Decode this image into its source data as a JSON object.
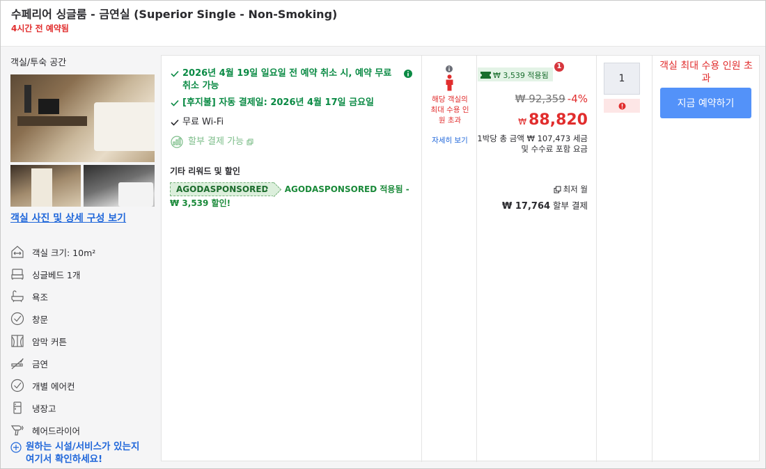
{
  "header": {
    "room_title": "수페리어 싱글룸 - 금연실 (Superior Single - Non-Smoking)",
    "booked_ago": "4시간 전 예약됨"
  },
  "left": {
    "room_type": "객실/투숙 공간",
    "photo_link": "객실 사진 및 상세 구성 보기",
    "amenities": [
      {
        "icon": "room-size-icon",
        "label": "객실 크기: 10m²"
      },
      {
        "icon": "single-bed-icon",
        "label": "싱글베드 1개"
      },
      {
        "icon": "bathtub-icon",
        "label": "욕조"
      },
      {
        "icon": "check-circle-icon",
        "label": "창문"
      },
      {
        "icon": "curtain-icon",
        "label": "암막 커튼"
      },
      {
        "icon": "no-smoking-icon",
        "label": "금연"
      },
      {
        "icon": "check-circle-icon",
        "label": "개별 에어컨"
      },
      {
        "icon": "refrigerator-icon",
        "label": "냉장고"
      },
      {
        "icon": "hair-dryer-icon",
        "label": "헤어드라이어"
      }
    ],
    "facility_link_line1": "원하는 시설/서비스가 있는지",
    "facility_link_line2": "여기서 확인하세요!"
  },
  "benefits": {
    "free_cancel": "2026년 4월 19일 일요일 전 예약 취소 시, 예약 무료 취소 가능",
    "pay_later": "[후지불] 자동 결제일: 2026년 4월 17일 금요일",
    "wifi": "무료 Wi-Fi",
    "installment": "할부 결제 가능",
    "other_title": "기타 리워드 및 할인",
    "promo_code": "AGODASPONSORED",
    "promo_text": "AGODASPONSORED 적용됨 - ₩ 3,539 할인!"
  },
  "capacity": {
    "warning": "해당 객실의 최대 수용 인원 초과",
    "details_link": "자세히 보기"
  },
  "price": {
    "coupon_label": "₩ 3,539 적용됨",
    "coupon_badge": "1",
    "original": "₩ 92,359",
    "discount": "-4%",
    "currency": "₩",
    "amount": "88,820",
    "note": "1박당 총 금액 ₩ 107,473 세금 및 수수료 포함 요금",
    "monthly_label": "최저 월",
    "monthly_amount": "₩ 17,764",
    "monthly_suffix": " 할부 결제"
  },
  "quantity": {
    "value": "1"
  },
  "action": {
    "limit_text": "객실 최대 수용 인원 초과",
    "book_label": "지금 예약하기"
  },
  "colors": {
    "accent_blue": "#5392f9",
    "link_blue": "#2067da",
    "warning_red": "#e12d2d",
    "benefit_green": "#0a8a44"
  }
}
